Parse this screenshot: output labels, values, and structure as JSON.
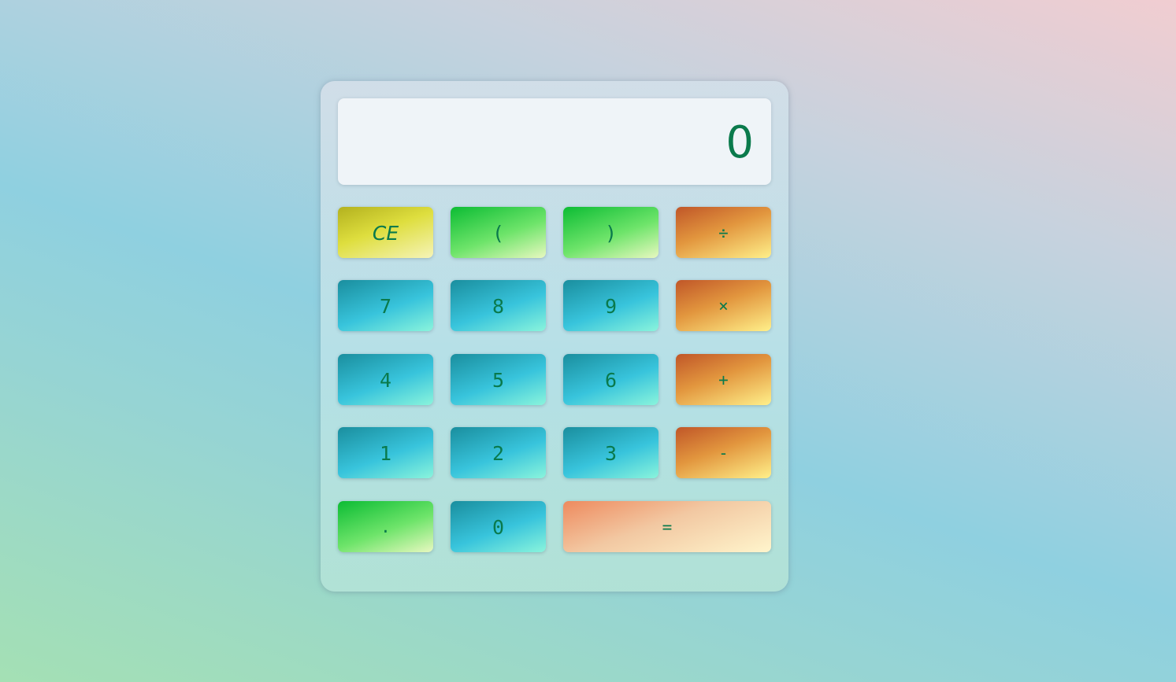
{
  "display": {
    "value": "0"
  },
  "keys": {
    "clear": "CE",
    "open_paren": "(",
    "close_paren": ")",
    "divide": "÷",
    "seven": "7",
    "eight": "8",
    "nine": "9",
    "multiply": "×",
    "four": "4",
    "five": "5",
    "six": "6",
    "add": "+",
    "one": "1",
    "two": "2",
    "three": "3",
    "subtract": "-",
    "decimal": ".",
    "zero": "0",
    "equals": "="
  },
  "colors": {
    "text": "#0a7a4c",
    "clear_key": "#dede3e",
    "paren_key": "#6ee46a",
    "digit_key": "#38c4dc",
    "operator_key": "#e2963e",
    "equals_key": "#f2c8a2"
  }
}
